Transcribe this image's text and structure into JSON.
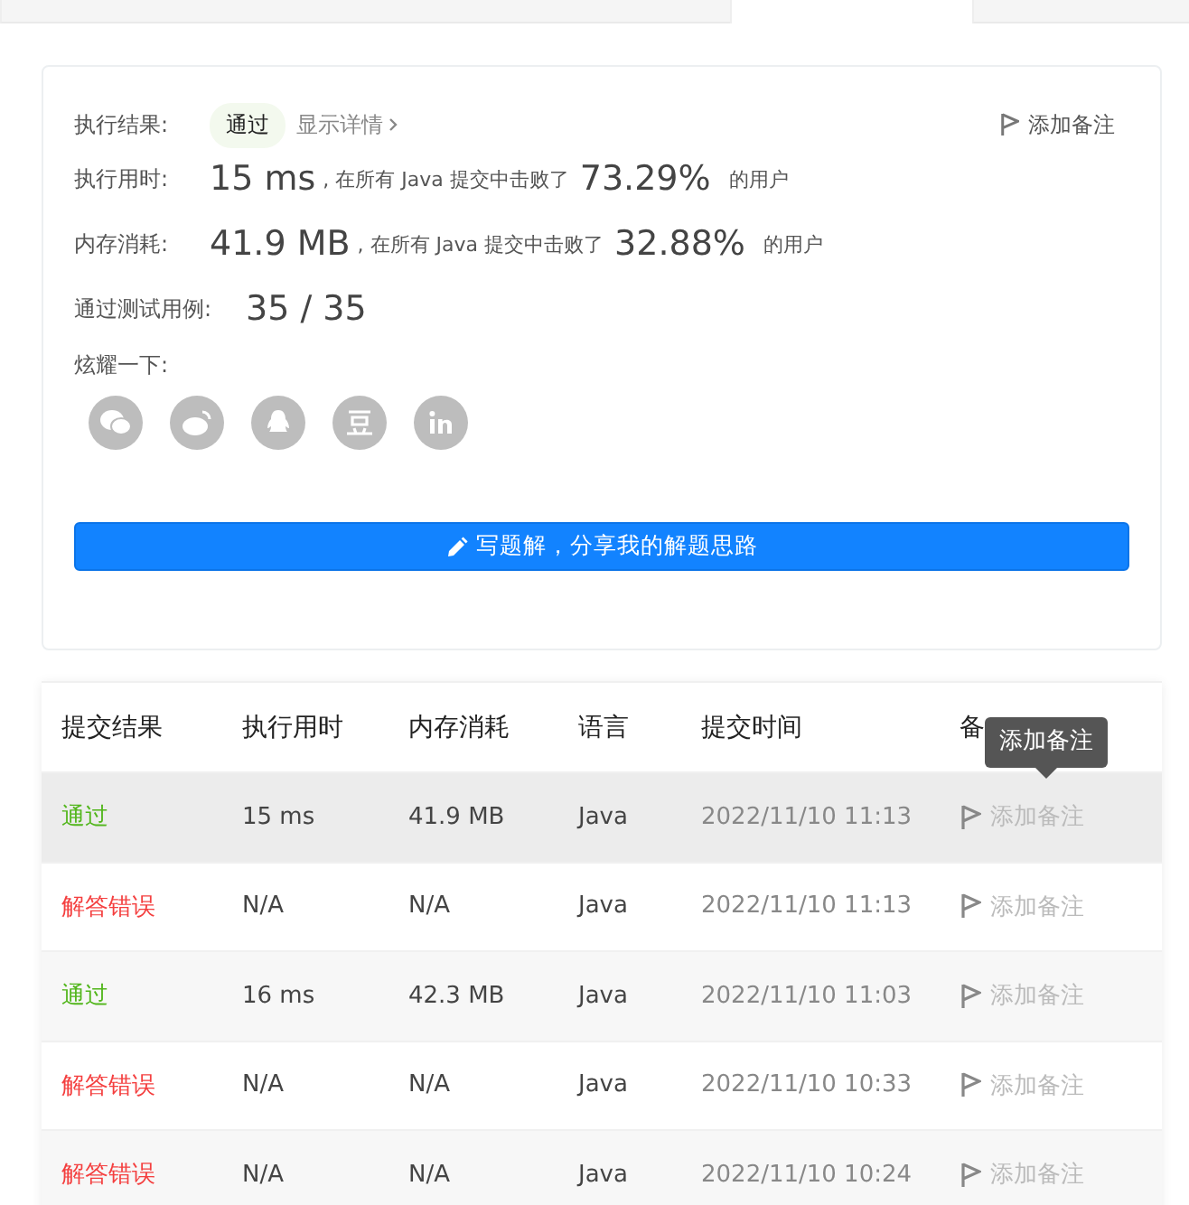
{
  "tabs": [
    {
      "selected": false
    },
    {
      "selected": true
    },
    {
      "selected": false
    }
  ],
  "result": {
    "label": "执行结果:",
    "status": "通过",
    "details_link": "显示详情",
    "add_note": "添加备注",
    "runtime": {
      "label": "执行用时:",
      "value": "15 ms",
      "text": ", 在所有 Java 提交中击败了",
      "percent": "73.29%",
      "suffix": "的用户"
    },
    "memory": {
      "label": "内存消耗:",
      "value": "41.9 MB",
      "text": ", 在所有 Java 提交中击败了",
      "percent": "32.88%",
      "suffix": "的用户"
    },
    "tests": {
      "label": "通过测试用例:",
      "value": "35 / 35"
    },
    "share": {
      "label": "炫耀一下:",
      "icons": [
        {
          "kind": "chat"
        },
        {
          "kind": "weibo"
        },
        {
          "kind": "qq"
        },
        {
          "kind": "douban"
        },
        {
          "kind": "linkedin"
        }
      ]
    },
    "write_button": "写题解，分享我的解题思路"
  },
  "table": {
    "columns": [
      "提交结果",
      "执行用时",
      "内存消耗",
      "语言",
      "提交时间",
      "备"
    ],
    "rows": [
      {
        "status": "通过",
        "kind": "accepted",
        "runtime": "15 ms",
        "memory": "41.9 MB",
        "language": "Java",
        "time": "2022/11/10 11:13",
        "note": "添加备注",
        "hovered": true
      },
      {
        "status": "解答错误",
        "kind": "wrong",
        "runtime": "N/A",
        "memory": "N/A",
        "language": "Java",
        "time": "2022/11/10 11:13",
        "note": "添加备注",
        "hovered": false
      },
      {
        "status": "通过",
        "kind": "accepted",
        "runtime": "16 ms",
        "memory": "42.3 MB",
        "language": "Java",
        "time": "2022/11/10 11:03",
        "note": "添加备注",
        "hovered": false
      },
      {
        "status": "解答错误",
        "kind": "wrong",
        "runtime": "N/A",
        "memory": "N/A",
        "language": "Java",
        "time": "2022/11/10 10:33",
        "note": "添加备注",
        "hovered": false
      },
      {
        "status": "解答错误",
        "kind": "wrong",
        "runtime": "N/A",
        "memory": "N/A",
        "language": "Java",
        "time": "2022/11/10 10:24",
        "note": "添加备注",
        "hovered": false
      }
    ]
  },
  "tooltip": "添加备注"
}
